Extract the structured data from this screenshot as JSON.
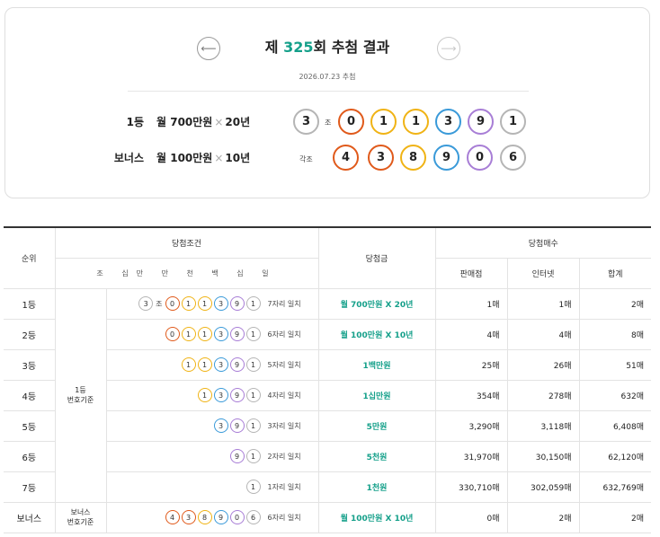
{
  "header": {
    "title_prefix": "제 ",
    "draw_no": "325",
    "title_suffix": "회 추첨 결과",
    "date": "2026.07.23 추첨",
    "prev_icon": "left-arrow-icon",
    "next_icon": "right-arrow-icon"
  },
  "first_prize": {
    "rank": "1등",
    "amount": "월 700만원",
    "times": "×",
    "period": "20년",
    "group": "3",
    "group_unit": "조",
    "numbers": [
      "0",
      "1",
      "1",
      "3",
      "9",
      "1"
    ]
  },
  "bonus_prize": {
    "rank": "보너스",
    "amount": "월 100만원",
    "times": "×",
    "period": "10년",
    "group_label": "각조",
    "numbers": [
      "4",
      "3",
      "8",
      "9",
      "0",
      "6"
    ]
  },
  "table": {
    "h_rank": "순위",
    "h_condition": "당첨조건",
    "h_condition_sub": "조 십만 만 천 백 십 일",
    "h_prize": "당첨금",
    "h_count": "당첨매수",
    "h_store": "판매점",
    "h_internet": "인터넷",
    "h_total": "합계",
    "basis_first": "1등\n번호기준",
    "basis_bonus": "보너스\n번호기준",
    "rows": [
      {
        "rank": "1등",
        "group": "3",
        "group_unit": "조",
        "balls": [
          "0",
          "1",
          "1",
          "3",
          "9",
          "1"
        ],
        "match": "7자리 일치",
        "prize": "월 700만원 X 20년",
        "store": "1매",
        "internet": "1매",
        "total": "2매"
      },
      {
        "rank": "2등",
        "balls": [
          "0",
          "1",
          "1",
          "3",
          "9",
          "1"
        ],
        "match": "6자리 일치",
        "prize": "월 100만원 X 10년",
        "store": "4매",
        "internet": "4매",
        "total": "8매"
      },
      {
        "rank": "3등",
        "balls": [
          "1",
          "1",
          "3",
          "9",
          "1"
        ],
        "match": "5자리 일치",
        "prize": "1백만원",
        "store": "25매",
        "internet": "26매",
        "total": "51매"
      },
      {
        "rank": "4등",
        "balls": [
          "1",
          "3",
          "9",
          "1"
        ],
        "match": "4자리 일치",
        "prize": "1십만원",
        "store": "354매",
        "internet": "278매",
        "total": "632매"
      },
      {
        "rank": "5등",
        "balls": [
          "3",
          "9",
          "1"
        ],
        "match": "3자리 일치",
        "prize": "5만원",
        "store": "3,290매",
        "internet": "3,118매",
        "total": "6,408매"
      },
      {
        "rank": "6등",
        "balls": [
          "9",
          "1"
        ],
        "match": "2자리 일치",
        "prize": "5천원",
        "store": "31,970매",
        "internet": "30,150매",
        "total": "62,120매"
      },
      {
        "rank": "7등",
        "balls": [
          "1"
        ],
        "match": "1자리 일치",
        "prize": "1천원",
        "store": "330,710매",
        "internet": "302,059매",
        "total": "632,769매"
      },
      {
        "rank": "보너스",
        "balls": [
          "4",
          "3",
          "8",
          "9",
          "0",
          "6"
        ],
        "match": "6자리 일치",
        "prize": "월 100만원 X 10년",
        "store": "0매",
        "internet": "2매",
        "total": "2매"
      }
    ]
  },
  "colors": {
    "accent": "#15a08a",
    "red": "#e05a1b",
    "yellow": "#f0b315",
    "blue": "#3a9ad9",
    "purple": "#a87ed6",
    "gray": "#b5b5b5"
  }
}
